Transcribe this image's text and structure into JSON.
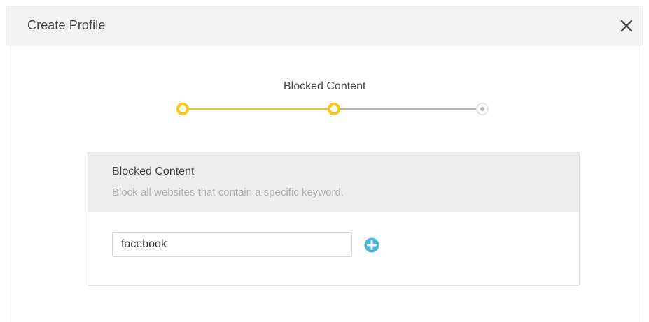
{
  "dialog": {
    "title": "Create Profile"
  },
  "stepper": {
    "current_step_label": "Blocked Content",
    "steps_total": 3,
    "current_step": 2
  },
  "panel": {
    "title": "Blocked Content",
    "description": "Block all websites that contain a specific keyword."
  },
  "keyword_input": {
    "value": "facebook"
  },
  "icons": {
    "close": "close-icon",
    "add": "plus-circle-icon"
  },
  "colors": {
    "accent_yellow": "#f5c518",
    "add_button": "#4ab7d8",
    "inactive_line": "#b3b3b3",
    "header_bg": "#f2f2f2"
  }
}
